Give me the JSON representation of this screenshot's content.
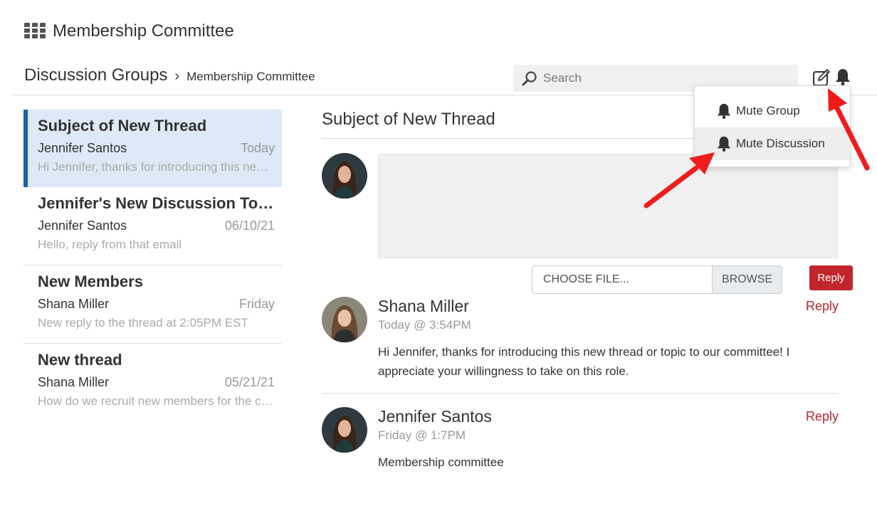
{
  "app": {
    "title": "Membership Committee",
    "menu_icon": "grid-icon"
  },
  "breadcrumb": {
    "root": "Discussion Groups",
    "separator": "›",
    "current": "Membership Committee"
  },
  "search": {
    "placeholder": "Search",
    "icon": "search-icon"
  },
  "toolbar": {
    "compose_icon": "compose-icon",
    "notifications_icon": "bell-icon"
  },
  "mute_menu": {
    "items": [
      {
        "label": "Mute Group",
        "icon": "bell-icon"
      },
      {
        "label": "Mute Discussion",
        "icon": "bell-icon",
        "highlighted": true
      }
    ]
  },
  "threads": [
    {
      "title": "Subject of New Thread",
      "author": "Jennifer Santos",
      "date": "Today",
      "preview": "Hi Jennifer, thanks for introducing this new thread or topic to our committee!",
      "active": true
    },
    {
      "title": "Jennifer's New Discussion Topic",
      "author": "Jennifer Santos",
      "date": "06/10/21",
      "preview": "Hello, reply from that email"
    },
    {
      "title": "New Members",
      "author": "Shana Miller",
      "date": "Friday",
      "preview": "New reply to the thread at 2:05PM EST"
    },
    {
      "title": "New thread",
      "author": "Shana Miller",
      "date": "05/21/21",
      "preview": "How do we recruit new members for the committee?"
    }
  ],
  "detail": {
    "title": "Subject of New Thread",
    "composer": {
      "file_label": "CHOOSE FILE...",
      "browse_label": "BROWSE",
      "reply_label": "Reply"
    },
    "posts": [
      {
        "author": "Shana Miller",
        "time": "Today @ 3:54PM",
        "body": "Hi Jennifer, thanks for introducing this new thread or topic to our committee! I appreciate your willingness to take on this role.",
        "reply_label": "Reply"
      },
      {
        "author": "Jennifer Santos",
        "time": "Friday @ 1:7PM",
        "body": "Membership committee",
        "reply_label": "Reply"
      }
    ]
  },
  "colors": {
    "accent_blue": "#1a5fa8",
    "active_bg": "#dde9f7",
    "reply_red": "#c2252b",
    "link_red": "#b3282d",
    "arrow_red": "#ee1c1c"
  }
}
